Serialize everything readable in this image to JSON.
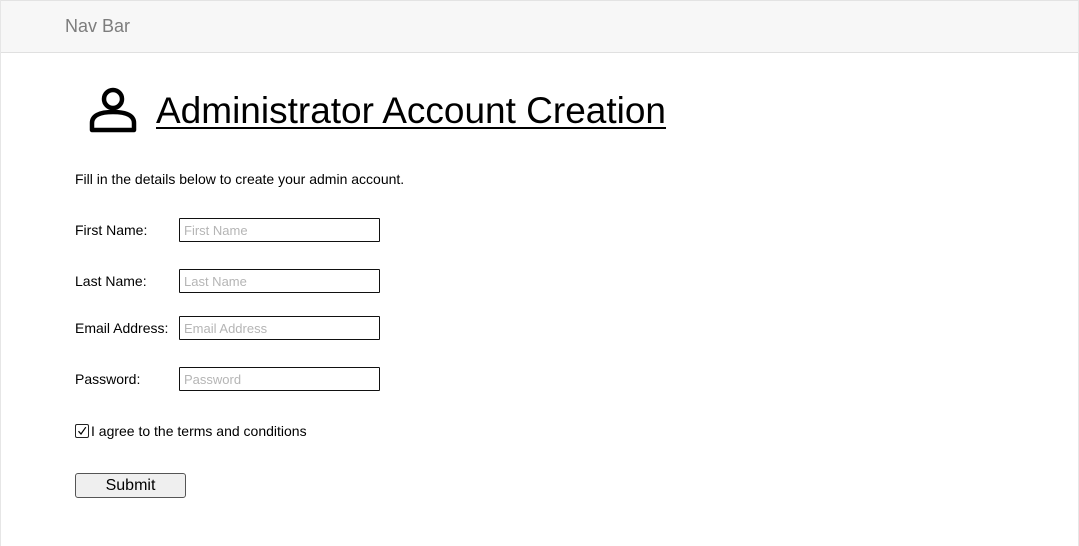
{
  "navbar": {
    "brand": "Nav Bar"
  },
  "header": {
    "icon": "user-icon",
    "title": "Administrator Account Creation"
  },
  "intro": "Fill in the details below to create your admin account.",
  "form": {
    "first_name": {
      "label": "First Name:",
      "placeholder": "First Name",
      "value": ""
    },
    "last_name": {
      "label": "Last Name:",
      "placeholder": "Last Name",
      "value": ""
    },
    "email": {
      "label": "Email Address:",
      "placeholder": "Email Address",
      "value": ""
    },
    "password": {
      "label": "Password:",
      "placeholder": "Password",
      "value": ""
    },
    "terms": {
      "label": "I agree to the terms and conditions",
      "checked": true
    },
    "submit_label": "Submit"
  }
}
